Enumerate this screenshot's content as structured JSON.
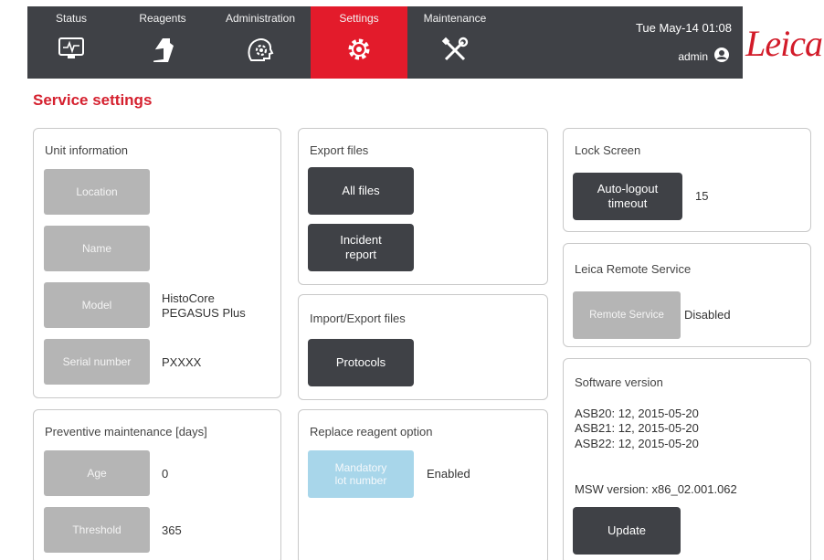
{
  "nav": {
    "tabs": [
      {
        "label": "Status",
        "icon": "monitor-icon"
      },
      {
        "label": "Reagents",
        "icon": "reagent-bottle-icon"
      },
      {
        "label": "Administration",
        "icon": "admin-gear-head-icon"
      },
      {
        "label": "Settings",
        "icon": "gear-icon"
      },
      {
        "label": "Maintenance",
        "icon": "tools-icon"
      }
    ],
    "datetime": "Tue May-14 01:08",
    "user": "admin",
    "brand": "Leica"
  },
  "colors": {
    "active_tab": "#e31b2b",
    "navbar": "#3f4146",
    "title": "#d5212f",
    "brand": "#d21b29"
  },
  "page_title": "Service settings",
  "unit_info": {
    "title": "Unit information",
    "location_label": "Location",
    "name_label": "Name",
    "model_label": "Model",
    "model_value_line1": "HistoCore",
    "model_value_line2": "PEGASUS Plus",
    "serial_label": "Serial number",
    "serial_value": "PXXXX"
  },
  "preventive": {
    "title": "Preventive maintenance [days]",
    "age_label": "Age",
    "age_value": "0",
    "threshold_label": "Threshold",
    "threshold_value": "365"
  },
  "export_files": {
    "title": "Export files",
    "all_files_label": "All files",
    "incident_line1": "Incident",
    "incident_line2": "report"
  },
  "import_export": {
    "title": "Import/Export files",
    "protocols_label": "Protocols"
  },
  "replace_reagent": {
    "title": "Replace reagent option",
    "mandatory_line1": "Mandatory",
    "mandatory_line2": "lot number",
    "status": "Enabled"
  },
  "lock_screen": {
    "title": "Lock Screen",
    "autologout_line1": "Auto-logout",
    "autologout_line2": "timeout",
    "value": "15"
  },
  "remote_service": {
    "title": "Leica Remote Service",
    "button_label": "Remote Service",
    "status": "Disabled"
  },
  "software": {
    "title": "Software version",
    "lines": [
      "ASB20: 12, 2015-05-20",
      "ASB21: 12, 2015-05-20",
      "ASB22: 12, 2015-05-20"
    ],
    "msw": "MSW version: x86_02.001.062",
    "update_label": "Update"
  }
}
